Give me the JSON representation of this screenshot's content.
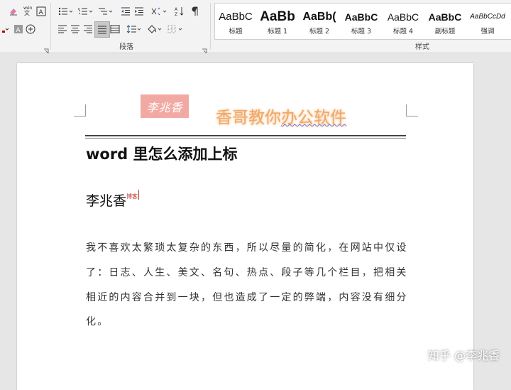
{
  "ribbon": {
    "paragraph_group_label": "段落",
    "styles_group_label": "样式",
    "styles": [
      {
        "sample": "AaBbC",
        "name": "标题",
        "size": 15,
        "bold": false
      },
      {
        "sample": "AaBb",
        "name": "标题 1",
        "size": 19,
        "bold": true
      },
      {
        "sample": "AaBb(",
        "name": "标题 2",
        "size": 16,
        "bold": true
      },
      {
        "sample": "AaBbC",
        "name": "标题 3",
        "size": 14,
        "bold": true
      },
      {
        "sample": "AaBbC",
        "name": "标题 4",
        "size": 14,
        "bold": false
      },
      {
        "sample": "AaBbC",
        "name": "副标题",
        "size": 14,
        "bold": true
      },
      {
        "sample": "AaBbCcDd",
        "name": "强调",
        "size": 10,
        "bold": false,
        "italic": true
      }
    ]
  },
  "page": {
    "stamp_text": "李兆香",
    "header_title_a": "香哥教你",
    "header_title_b": "办公软件",
    "heading": "word 里怎么添加上标",
    "author": "李兆香",
    "author_superscript": "博客",
    "body_lines": [
      "我不喜欢太繁琐太复杂的东西，所以尽量的简化，在网站中仅设",
      "了：日志、人生、美文、名句、热点、段子等几个栏目，把相关",
      "相近的内容合并到一块，但也造成了一定的弊端，内容没有细分",
      "化。"
    ]
  },
  "watermark": "知乎 @李兆香",
  "colors": {
    "stamp": "#f2a9a4",
    "header_title": "#f0a86a",
    "superscript": "#c0392b"
  }
}
